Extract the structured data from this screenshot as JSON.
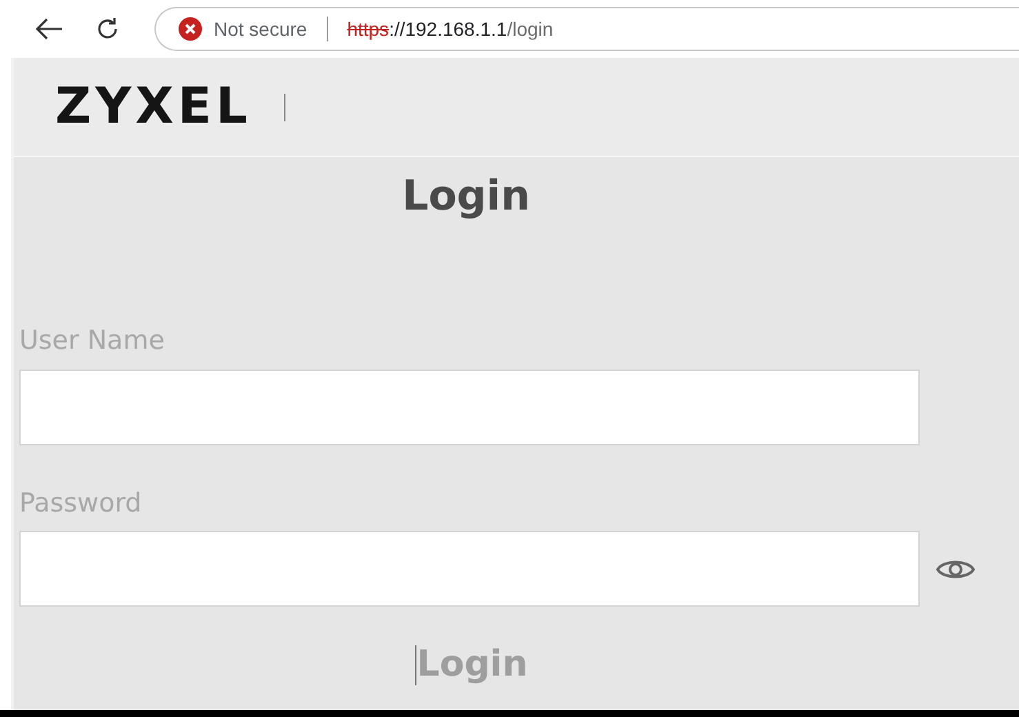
{
  "browser": {
    "security": "Not secure",
    "url_scheme": "https",
    "url_host": "://192.168.1.1",
    "url_path": "/login"
  },
  "header": {
    "logo": "ZYXEL"
  },
  "form": {
    "title": "Login",
    "fields": [
      {
        "label": "User Name",
        "kind": "text"
      },
      {
        "label": "Password",
        "kind": "password"
      }
    ],
    "submit": "Login"
  }
}
